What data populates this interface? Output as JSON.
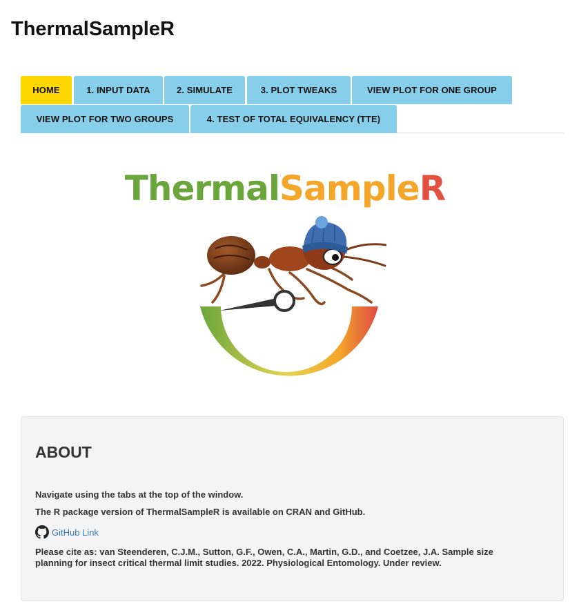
{
  "app": {
    "title": "ThermalSampleR"
  },
  "tabs": [
    {
      "label": "HOME",
      "active": true
    },
    {
      "label": "1. INPUT DATA",
      "active": false
    },
    {
      "label": "2. SIMULATE",
      "active": false
    },
    {
      "label": "3. PLOT TWEAKS",
      "active": false
    },
    {
      "label": "VIEW PLOT FOR ONE GROUP",
      "active": false
    },
    {
      "label": "VIEW PLOT FOR TWO GROUPS",
      "active": false
    },
    {
      "label": "4. TEST OF TOTAL EQUIVALENCY (TTE)",
      "active": false
    }
  ],
  "logo": {
    "part1": "Thermal",
    "part2": "Sample",
    "part3": "R",
    "colors": {
      "green": "#6aa63c",
      "orange": "#f4a62a",
      "red": "#e0523f"
    },
    "icon": "ant-thermometer-gauge-logo"
  },
  "about": {
    "title": "ABOUT",
    "nav_text": "Navigate using the tabs at the top of the window.",
    "package_text": "The R package version of ThermalSampleR is available on CRAN and GitHub.",
    "github_link": "GitHub Link",
    "github_icon": "github-icon",
    "cite_line1": "Please cite as: van Steenderen, C.J.M., Sutton, G.F., Owen, C.A., Martin, G.D., and Coetzee, J.A. Sample size",
    "cite_line2": "planning for insect critical thermal limit studies. 2022. Physiological Entomology. Under review."
  },
  "colors": {
    "tab_background": "#87ceeb",
    "tab_active": "#ffd700",
    "panel_background": "#f4f4f4",
    "link": "#337ab7"
  }
}
